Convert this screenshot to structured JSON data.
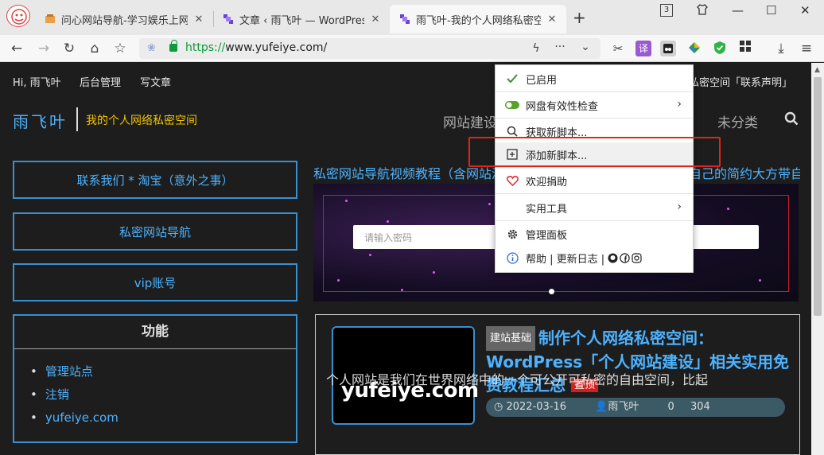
{
  "browser": {
    "tabs": [
      {
        "title": "问心网站导航-学习娱乐上网助手",
        "close": "✕"
      },
      {
        "title": "文章 ‹ 雨飞叶 — WordPress",
        "close": "✕"
      },
      {
        "title": "雨飞叶-我的个人网络私密空间",
        "close": "✕"
      }
    ],
    "new_tab": "+",
    "window_controls": {
      "tabcount": "3",
      "minimize": "—",
      "maximize": "☐",
      "close": "✕"
    },
    "url_scheme": "https://",
    "url_rest": "www.yufeiye.com/",
    "nav_icons": {
      "back": "←",
      "forward": "→",
      "reload": "↻",
      "home": "⌂",
      "star": "☆",
      "bolt": "ϟ",
      "more": "···",
      "dropdown": "⌄",
      "scissors": "✂",
      "download": "⤓",
      "menu": "≡"
    },
    "ext_badge": "1"
  },
  "admin_bar": {
    "greeting": "Hi, 雨飞叶",
    "dashboard": "后台管理",
    "write": "写文章",
    "right_text": "私密空间「联系声明」"
  },
  "site": {
    "brand": "雨飞叶",
    "tagline": "我的个人网络私密空间",
    "nav": [
      "网站建设",
      "未分类"
    ]
  },
  "sidebar": {
    "boxes": [
      "联系我们 * 淘宝（意外之事）",
      "私密网站导航",
      "vip账号"
    ],
    "function_title": "功能",
    "function_items": [
      "管理站点",
      "注销",
      "yufeiye.com"
    ]
  },
  "slider": {
    "title": "私密网站导航视频教程（含网站源码），每个人都应该要有一个属于自己的简约大方带自适应响应式密码验...",
    "password_placeholder": "请输入密码"
  },
  "post": {
    "thumb_faces": "😊😉😊😜",
    "thumb_domain": "yufeiye.com",
    "category": "建站基础",
    "title": "制作个人网络私密空间：WordPress「个人网站建设」相关实用免费教程汇总",
    "pin": "置顶",
    "date": "2022-03-16",
    "author": "雨飞叶",
    "comments": "0",
    "views": "304",
    "excerpt": "个人网站是我们在世界网络中的一个可公开可私密的自由空间，比起"
  },
  "menu": {
    "items": [
      {
        "label": "已启用",
        "icon": "check-icon"
      },
      {
        "label": "网盘有效性检查",
        "icon": "toggle-icon",
        "submenu": "›"
      },
      {
        "label": "获取新脚本...",
        "icon": "search-icon"
      },
      {
        "label": "添加新脚本...",
        "icon": "plus-square-icon"
      },
      {
        "label": "欢迎捐助",
        "icon": "heart-icon"
      },
      {
        "label": "实用工具",
        "icon": "",
        "submenu": "›"
      },
      {
        "label": "管理面板",
        "icon": "gear-icon"
      },
      {
        "label": "帮助 | 更新日志 |",
        "icon": "info-icon"
      }
    ]
  },
  "colors": {
    "accent": "#4db3ff",
    "highlight_box": "#e0241b",
    "tagline": "#f2c200"
  }
}
